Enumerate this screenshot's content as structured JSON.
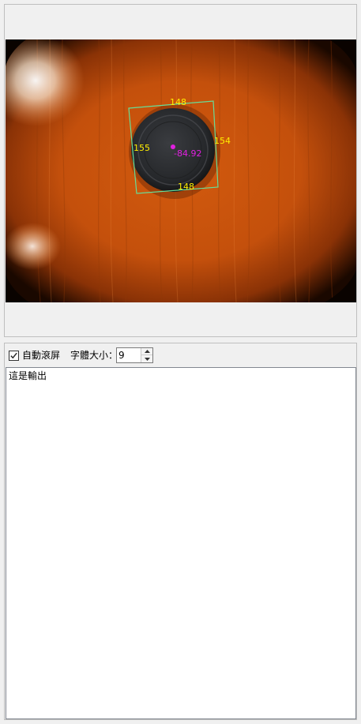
{
  "image_panel": {
    "measurements": {
      "top_width": "148",
      "bottom_width": "148",
      "left_height": "155",
      "right_height": "154",
      "angle": "-84.92"
    },
    "colors": {
      "bounding_box": "#66dd99",
      "dimension_text": "#ffee00",
      "center_marker": "#e020e0"
    }
  },
  "toolbar": {
    "auto_scroll_label": "自動滾屏",
    "auto_scroll_checked": true,
    "font_size_label": "字體大小：",
    "font_size_value": "9"
  },
  "output": {
    "text": "這是輸出"
  }
}
